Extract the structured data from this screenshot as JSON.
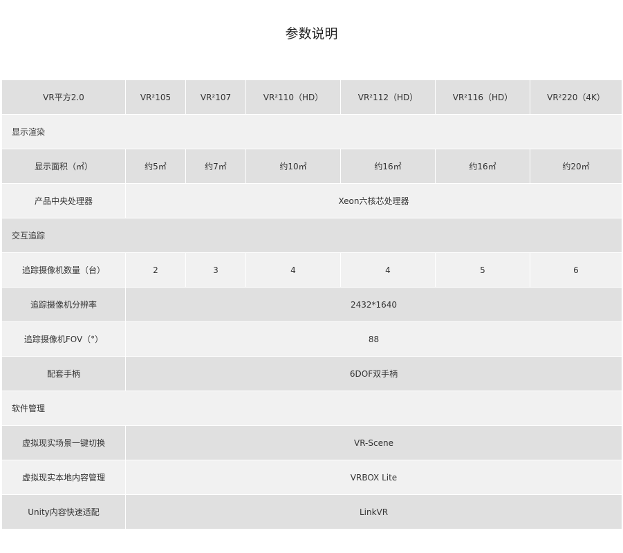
{
  "title": "参数说明",
  "header": {
    "label": "VR平方2.0",
    "models": [
      "VR²105",
      "VR²107",
      "VR²110（HD）",
      "VR²112（HD）",
      "VR²116（HD）",
      "VR²220（4K）"
    ]
  },
  "sections": {
    "display": "显示渲染",
    "tracking": "交互追踪",
    "software": "软件管理"
  },
  "rows": {
    "display_area": {
      "label": "显示面积（㎡）",
      "values": [
        "约5㎡",
        "约7㎡",
        "约10㎡",
        "约16㎡",
        "约16㎡",
        "约20㎡"
      ]
    },
    "cpu": {
      "label": "产品中央处理器",
      "value": "Xeon六核芯处理器"
    },
    "camera_count": {
      "label": "追踪摄像机数量（台）",
      "values": [
        "2",
        "3",
        "4",
        "4",
        "5",
        "6"
      ]
    },
    "camera_resolution": {
      "label": "追踪摄像机分辨率",
      "value": "2432*1640"
    },
    "camera_fov": {
      "label": "追踪摄像机FOV（°）",
      "value": "88"
    },
    "controller": {
      "label": "配套手柄",
      "value": "6DOF双手柄"
    },
    "scene_switch": {
      "label": "虚拟现实场景一键切换",
      "value": "VR-Scene"
    },
    "content_mgmt": {
      "label": "虚拟现实本地内容管理",
      "value": "VRBOX Lite"
    },
    "unity_adapt": {
      "label": "Unity内容快速适配",
      "value": "LinkVR"
    }
  },
  "colors": {
    "row_dark": "#e0e0e0",
    "row_light": "#f1f1f1",
    "text": "#333333"
  }
}
